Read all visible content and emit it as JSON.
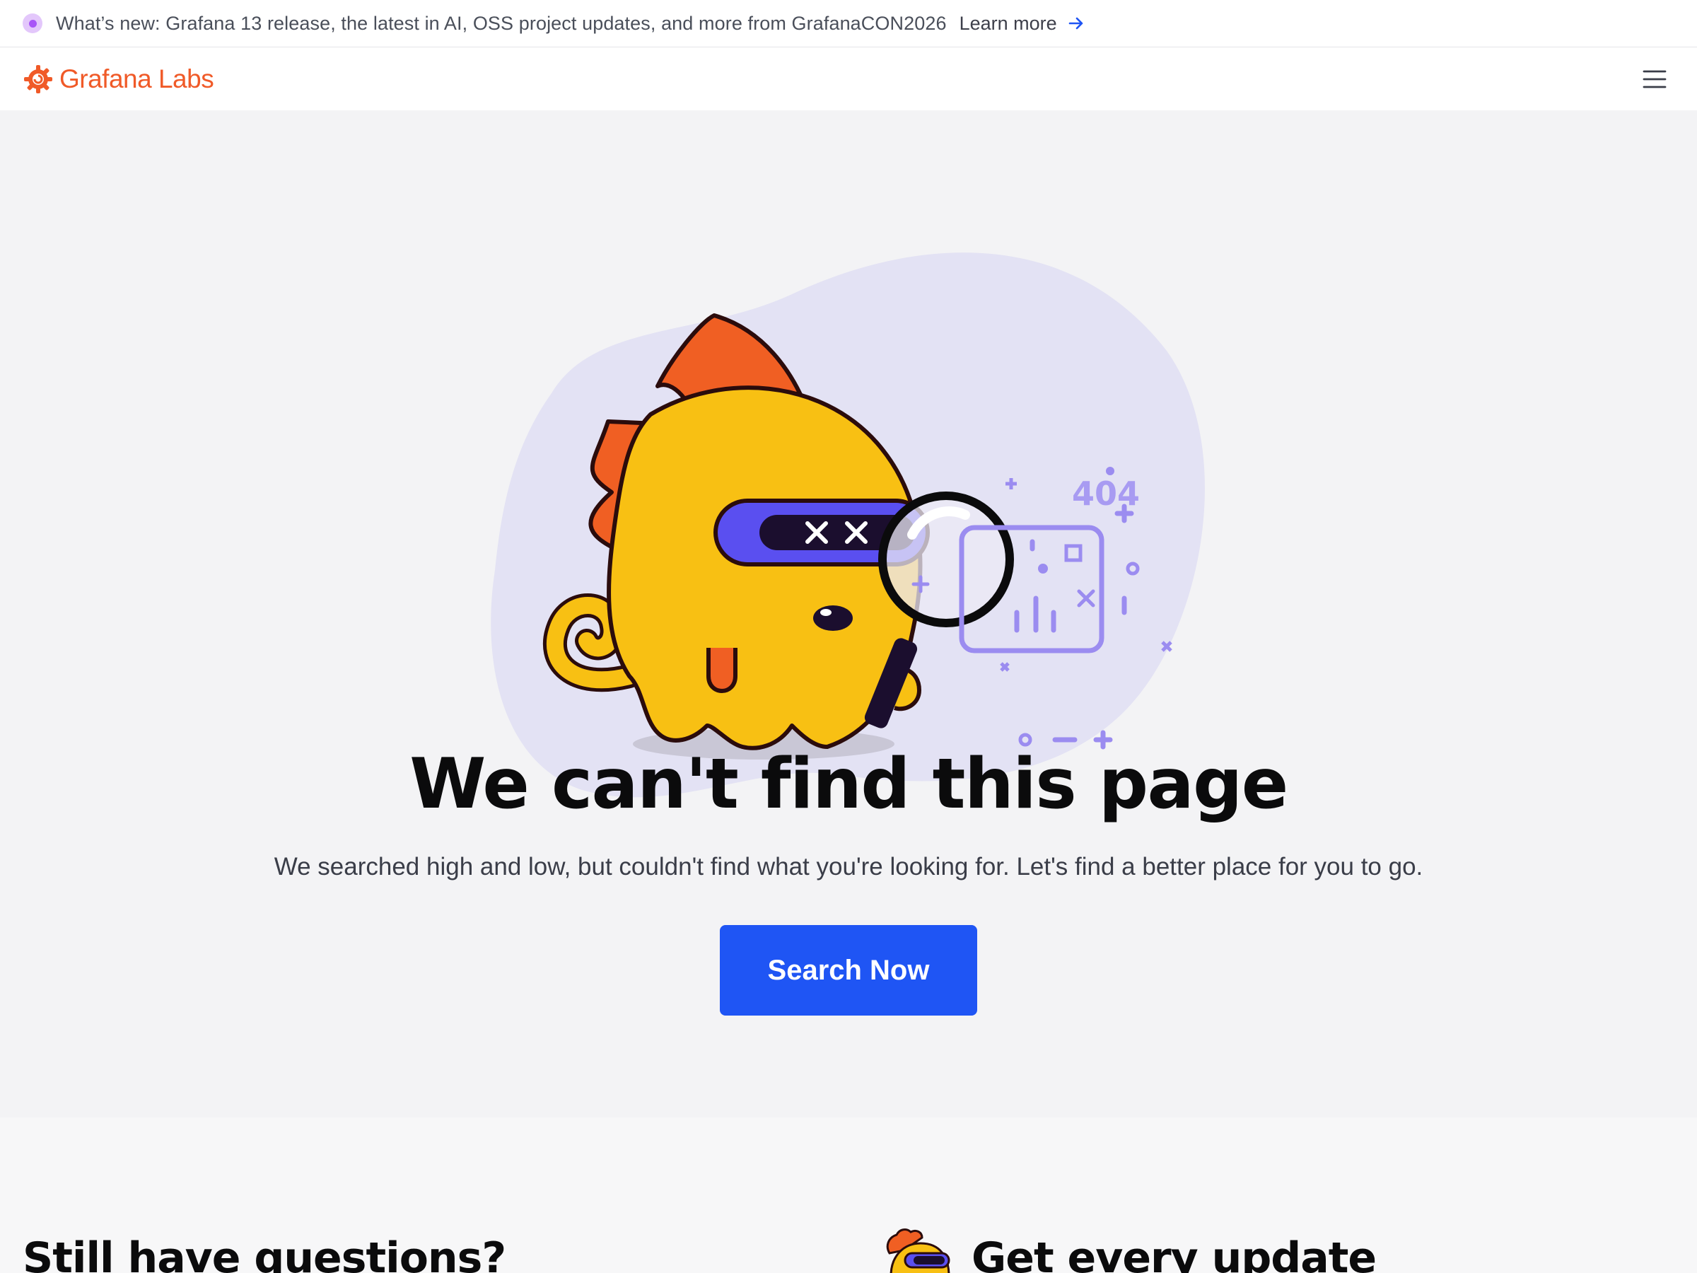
{
  "announcement": {
    "message": "What’s new: Grafana 13 release, the latest in AI, OSS project updates, and more from GrafanaCON2026",
    "link_label": "Learn more",
    "icons": [
      "status-dot-icon",
      "arrow-right-icon"
    ]
  },
  "nav": {
    "logo_text": "Grafana Labs",
    "menu_icon": "hamburger-menu-icon"
  },
  "hero": {
    "illustration_label": "404",
    "title": "We can't find this page",
    "subtitle": "We searched high and low, but couldn't find what you're looking for. Let's find a better place for you to go.",
    "search_button": "Search Now"
  },
  "footer_sections": {
    "questions_title": "Still have questions?",
    "update_title": "Get every update"
  },
  "colors": {
    "brand_orange": "#f05a28",
    "primary_blue": "#1f55f4",
    "hero_bg": "#f3f3f5",
    "blob": "#e3e2f4",
    "mascot_yellow": "#f8c013",
    "visor_purple": "#5a4ff0",
    "accent_lavender": "#9b8cf0"
  }
}
